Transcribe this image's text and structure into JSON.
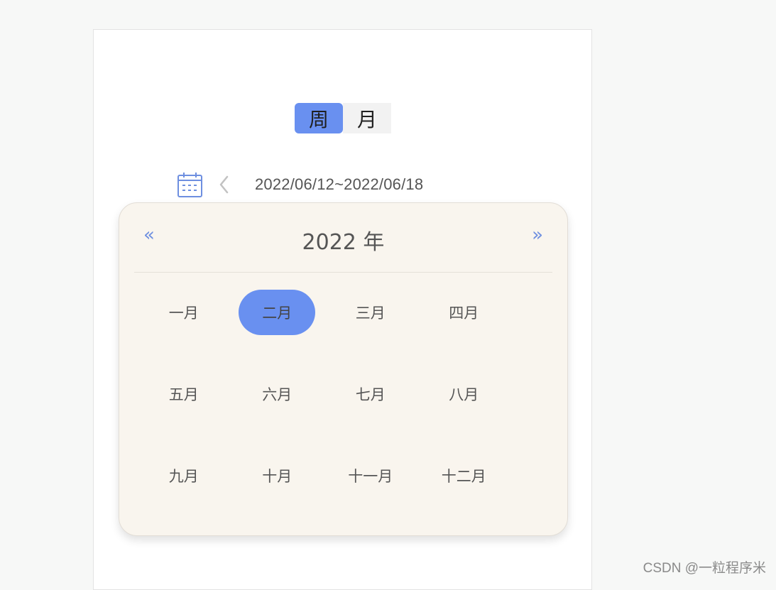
{
  "toggle": {
    "week_label": "周",
    "month_label": "月",
    "active": "week"
  },
  "date_range": {
    "text": "2022/06/12~2022/06/18",
    "calendar_icon": "calendar-icon",
    "prev_icon": "chevron-left-icon"
  },
  "picker": {
    "year_label": "2022 年",
    "prev_year_symbol": "«",
    "next_year_symbol": "»",
    "selected_month_index": 1,
    "months": [
      "一月",
      "二月",
      "三月",
      "四月",
      "五月",
      "六月",
      "七月",
      "八月",
      "九月",
      "十月",
      "十一月",
      "十二月"
    ]
  },
  "colors": {
    "accent": "#6990f0",
    "popup_bg": "#f9f5ee",
    "icon": "#6e8fe0"
  },
  "watermark": "CSDN @一粒程序米"
}
